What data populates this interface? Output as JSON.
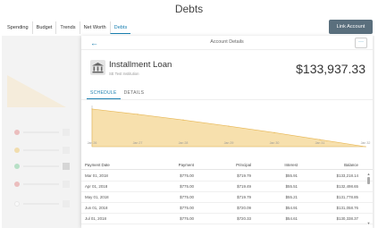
{
  "header": {
    "title": "Debts"
  },
  "nav": {
    "tabs": [
      "Spending",
      "Budget",
      "Trends",
      "Net Worth",
      "Debts"
    ],
    "active": "Debts"
  },
  "link_account": "Link Account",
  "modal": {
    "title": "Account Details",
    "menu": "···",
    "back": "←",
    "account_name": "Installment Loan",
    "institution": "SE Test Institution",
    "balance": "$133,937.33",
    "tabs": [
      "SCHEDULE",
      "DETAILS"
    ],
    "active_tab": "SCHEDULE"
  },
  "chart_data": {
    "type": "area",
    "x": [
      "Jan 26",
      "Jan 27",
      "Jan 28",
      "Jan 29",
      "Jan 30",
      "Jan 31",
      "Jan 32"
    ],
    "series": [
      {
        "values": [
          133.9,
          115,
          95,
          73,
          50,
          25,
          0
        ]
      }
    ],
    "ylim": [
      0,
      140
    ],
    "color": "#f5d899"
  },
  "table": {
    "headers": [
      "Payment Date",
      "Payment",
      "Principal",
      "Interest",
      "Balance"
    ],
    "rows": [
      [
        "Mar 01, 2018",
        "$775.00",
        "$719.79",
        "$55.91",
        "$133,218.14"
      ],
      [
        "Apr 01, 2018",
        "$775.00",
        "$719.49",
        "$55.51",
        "$132,498.65"
      ],
      [
        "May 01, 2018",
        "$775.00",
        "$719.79",
        "$55.21",
        "$131,778.85"
      ],
      [
        "Jun 01, 2018",
        "$775.00",
        "$720.09",
        "$54.91",
        "$131,058.76"
      ],
      [
        "Jul 01, 2018",
        "$775.00",
        "$720.33",
        "$54.61",
        "$130,338.37"
      ]
    ]
  },
  "colors": {
    "accent": "#1a7fb0",
    "button": "#5a6f7d",
    "chart_fill": "#f5d899"
  }
}
